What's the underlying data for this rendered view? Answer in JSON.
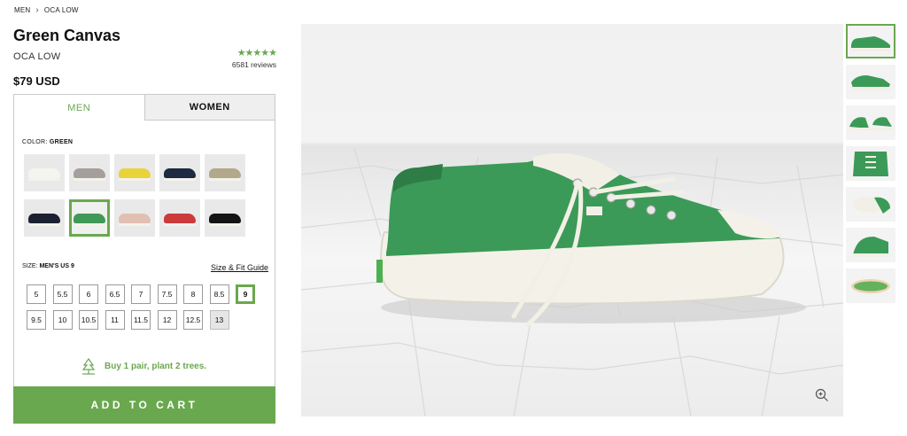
{
  "breadcrumb": {
    "level1": "MEN",
    "level2": "OCA LOW"
  },
  "product": {
    "title": "Green Canvas",
    "subtitle": "OCA LOW",
    "price": "$79 USD",
    "stars": "★★★★★",
    "rating": 5,
    "reviews": "6581 reviews"
  },
  "tabs": {
    "men": "MEN",
    "women": "WOMEN",
    "active": "men"
  },
  "color": {
    "label": "COLOR:",
    "value": "GREEN"
  },
  "swatch_colors": [
    "#f5f5f0",
    "#a59f9c",
    "#e9d33a",
    "#1d2a3f",
    "#b2a88a",
    "#1b2130",
    "#3f9a58",
    "#e2bfb3",
    "#cc3b3b",
    "#141414"
  ],
  "selected_swatch": 6,
  "size": {
    "label": "SIZE:",
    "value": "MEN'S US 9",
    "guide": "Size & Fit Guide"
  },
  "sizes": [
    "5",
    "5.5",
    "6",
    "6.5",
    "7",
    "7.5",
    "8",
    "8.5",
    "9",
    "9.5",
    "10",
    "10.5",
    "11",
    "11.5",
    "12",
    "12.5",
    "13"
  ],
  "selected_size": "9",
  "unavailable_size": "13",
  "promo": "Buy 1 pair, plant 2 trees.",
  "cart": "ADD TO CART",
  "accent": "#6aa84f"
}
